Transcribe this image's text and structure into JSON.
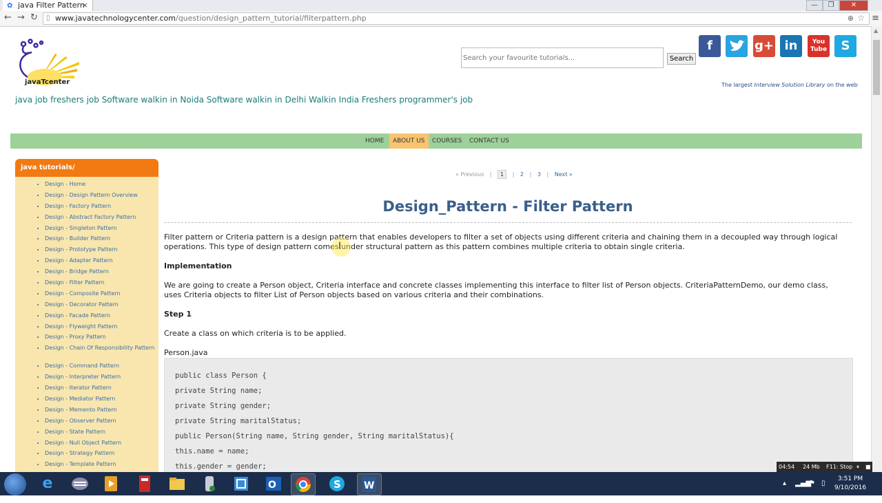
{
  "browser": {
    "tab_title": "java Filter Pattern",
    "tab_close": "×",
    "url_host": "www.javatechnologycenter.com",
    "url_path": "/question/design_pattern_tutorial/filterpattern.php",
    "window_controls": [
      "—",
      "❐",
      "✕"
    ]
  },
  "header": {
    "logo_text": "javaTcenter",
    "tagline": "java job freshers job Software walkin in Noida Software walkin in Delhi Walkin India Freshers programmer's job",
    "search_placeholder": "Search your favourite tutorials...",
    "search_button": "Search",
    "library_note_prefix": "The largest ",
    "library_note_em": "Interview Solution Library",
    "library_note_suffix": " on the web",
    "social": [
      {
        "name": "facebook-icon",
        "glyph": "f",
        "color": "#3b5998"
      },
      {
        "name": "twitter-icon",
        "glyph": "t",
        "color": "#2aa4e0"
      },
      {
        "name": "google-plus-icon",
        "glyph": "g+",
        "color": "#d84b37"
      },
      {
        "name": "linkedin-icon",
        "glyph": "in",
        "color": "#1a75b0"
      },
      {
        "name": "youtube-icon",
        "glyph": "You Tube",
        "color": "#d9322a"
      },
      {
        "name": "skype-icon",
        "glyph": "S",
        "color": "#1ea9e0"
      }
    ]
  },
  "nav": {
    "items": [
      "HOME",
      "ABOUT US",
      "COURSES",
      "CONTACT US"
    ],
    "active": "ABOUT US"
  },
  "sidebar": {
    "title": "java tutorials/",
    "items": [
      "Design - Home",
      "Design - Design Pattern Overview",
      "Design - Factory Pattern",
      "Design - Abstract Factory Pattern",
      "Design - Singleton Pattern",
      "Design - Builder Pattern",
      "Design - Prototype Pattern",
      "Design - Adapter Pattern",
      "Design - Bridge Pattern",
      "Design - Filter Pattern",
      "Design - Composite Pattern",
      "Design - Decorator Pattern",
      "Design - Facade Pattern",
      "Design - Flyweight Pattern",
      "Design - Proxy Pattern",
      "Design - Chain Of Responsibility Pattern",
      "Design - Command Pattern",
      "Design - Interpreter Pattern",
      "Design - Iterator Pattern",
      "Design - Mediator Pattern",
      "Design - Memento Pattern",
      "Design - Observer Pattern",
      "Design - State Pattern",
      "Design - Null Object Pattern",
      "Design - Strategy Pattern",
      "Design - Template Pattern"
    ]
  },
  "pager": {
    "prev": "« Previous",
    "pages": [
      "1",
      "2",
      "3"
    ],
    "current": "1",
    "next": "Next »",
    "sep": "|"
  },
  "content": {
    "title": "Design_Pattern - Filter Pattern",
    "intro": "Filter pattern or Criteria pattern is a design pattern that enables developers to filter a set of objects using different criteria and chaining them in a decoupled way through logical operations. This type of design pattern comes under structural pattern as this pattern combines multiple criteria to obtain single criteria.",
    "h_implementation": "Implementation",
    "impl_text": "We are going to create a Person object, Criteria interface and concrete classes implementing this interface to filter list of Person objects. CriteriaPatternDemo, our demo class, uses Criteria objects to filter List of Person objects based on various criteria and their combinations.",
    "h_step1": "Step 1",
    "step1_text": "Create a class on which criteria is to be applied.",
    "filename": "Person.java",
    "code": [
      "public class Person {",
      "private String name;",
      "private String gender;",
      "private String maritalStatus;",
      "public Person(String name, String gender, String maritalStatus){",
      "this.name = name;",
      "this.gender = gender;"
    ]
  },
  "recorder": {
    "time": "04:54",
    "size": "24 Mb",
    "hint": "F11: Stop",
    "pause": "⏸",
    "stop": "■"
  },
  "taskbar": {
    "clock_time": "3:51 PM",
    "clock_date": "9/10/2016"
  }
}
